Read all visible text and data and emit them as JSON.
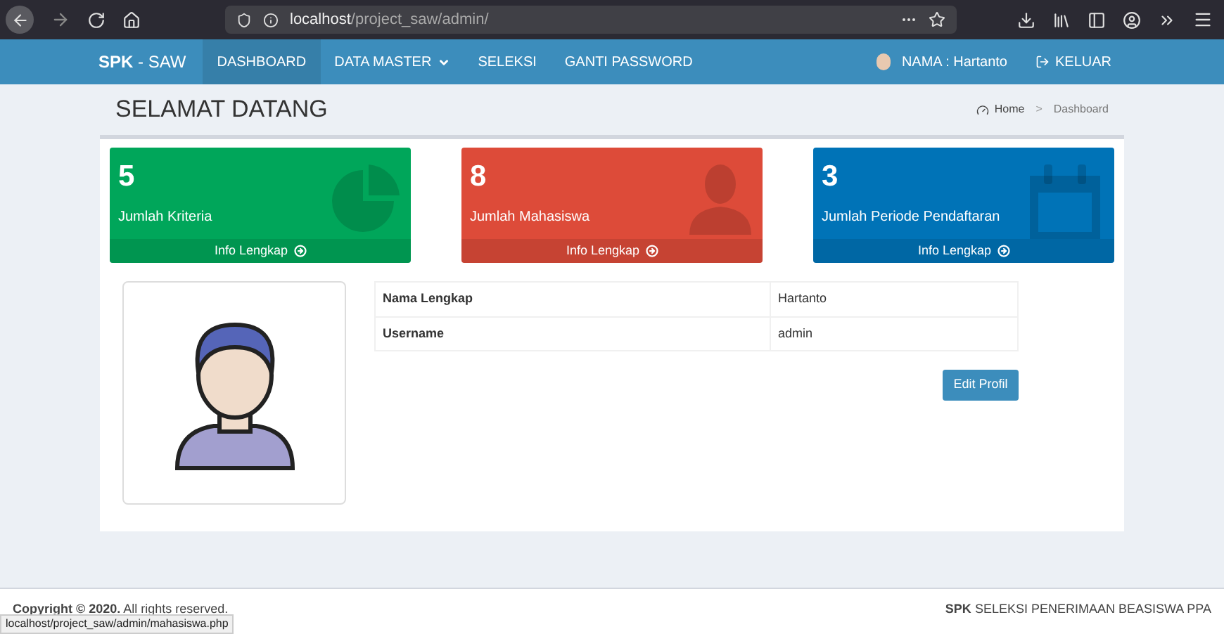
{
  "browser": {
    "url_host": "localhost",
    "url_path": "/project_saw/admin/"
  },
  "navbar": {
    "brand_bold": "SPK",
    "brand_rest": " - SAW",
    "items": [
      {
        "label": "DASHBOARD",
        "selected": true,
        "dropdown": false
      },
      {
        "label": "DATA MASTER",
        "selected": false,
        "dropdown": true
      },
      {
        "label": "SELEKSI",
        "selected": false,
        "dropdown": false
      },
      {
        "label": "GANTI PASSWORD",
        "selected": false,
        "dropdown": false
      }
    ],
    "user": "NAMA : Hartanto",
    "logout": "KELUAR"
  },
  "header": {
    "title": "SELAMAT DATANG",
    "breadcrumb": [
      "Home",
      ">",
      "Dashboard"
    ]
  },
  "cards": [
    {
      "value": "5",
      "label": "Jumlah Kriteria",
      "link": "Info Lengkap",
      "color": "#00a65a",
      "kind": "pie"
    },
    {
      "value": "8",
      "label": "Jumlah Mahasiswa",
      "link": "Info Lengkap",
      "color": "#dd4b39",
      "kind": "user"
    },
    {
      "value": "3",
      "label": "Jumlah Periode Pendaftaran",
      "link": "Info Lengkap",
      "color": "#0073b7",
      "kind": "calendar"
    }
  ],
  "profile": {
    "rows": [
      {
        "label": "Nama Lengkap",
        "value": "Hartanto"
      },
      {
        "label": "Username",
        "value": "admin"
      }
    ],
    "button": "Edit Profil"
  },
  "footer": {
    "left": "**Copyright © 2020.** All rights reserved.",
    "right": "**SPK** SELEKSI PENERIMAAN BEASISWA PPA"
  },
  "status_bar": "localhost/project_saw/admin/mahasiswa.php"
}
